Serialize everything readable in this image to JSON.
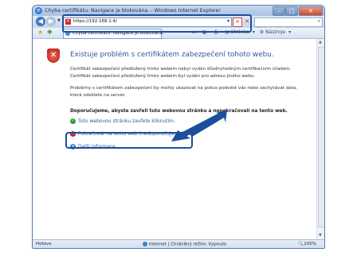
{
  "window": {
    "title": "Chyba certifikátu: Navigace je blokována. - Windows Internet Explorer"
  },
  "address_bar": {
    "url": "https://192.168.1.4/",
    "search_placeholder": "Aktivní vyhledávání"
  },
  "tab": {
    "label": "Chyba certifikátu: Navigace je blokována."
  },
  "command_bar": {
    "page_label": "Stránka",
    "tools_label": "Nástroje"
  },
  "page": {
    "heading": "Existuje problém s certifikátem zabezpečení tohoto webu.",
    "paragraph1": "Certifikát zabezpečení předložený tímto webem nebyl vydán důvěryhodným certifikačním úřadem. Certifikát zabezpečení předložený tímto webem byl vydán pro adresu jiného webu.",
    "paragraph2": "Problémy s certifikátem zabezpečení by mohly ukazovat na pokus podvést vás nebo zachytávat data, která odešlete na server.",
    "recommendation": "Doporučujeme, abyste zavřeli tuto webovou stránku a nepokračovali na tento web.",
    "links": {
      "close_page": "Tuto webovou stránku zavřete kliknutím.",
      "continue": "Pokračovat na tento web (nedoporučujeme)",
      "more_info": "Další informace"
    }
  },
  "status_bar": {
    "status_text": "Hotovo",
    "zone_text": "Internet | Chráněný režim: Vypnuto",
    "zoom": "100%"
  },
  "colors": {
    "annotation": "#1a4f9c",
    "heading": "#2d5899",
    "link": "#2a5aa8"
  }
}
